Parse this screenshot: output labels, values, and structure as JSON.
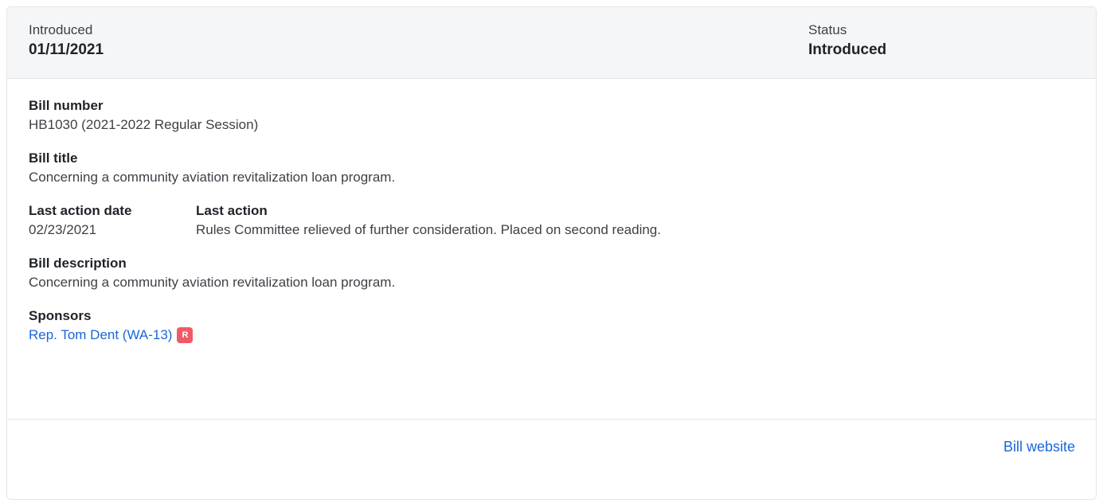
{
  "header": {
    "introduced_label": "Introduced",
    "introduced_value": "01/11/2021",
    "status_label": "Status",
    "status_value": "Introduced"
  },
  "bill": {
    "number_label": "Bill number",
    "number_value": "HB1030 (2021-2022 Regular Session)",
    "title_label": "Bill title",
    "title_value": "Concerning a community aviation revitalization loan program.",
    "last_action_date_label": "Last action date",
    "last_action_date_value": "02/23/2021",
    "last_action_label": "Last action",
    "last_action_value": "Rules Committee relieved of further consideration. Placed on second reading.",
    "description_label": "Bill description",
    "description_value": "Concerning a community aviation revitalization loan program."
  },
  "sponsors": {
    "label": "Sponsors",
    "items": [
      {
        "name": "Rep. Tom Dent (WA-13)",
        "party": "R",
        "party_color": "#f05a66"
      }
    ]
  },
  "footer": {
    "website_label": "Bill website"
  },
  "colors": {
    "link": "#1a66d9",
    "header_bg": "#f5f6f7",
    "border": "#e3e5e8"
  }
}
